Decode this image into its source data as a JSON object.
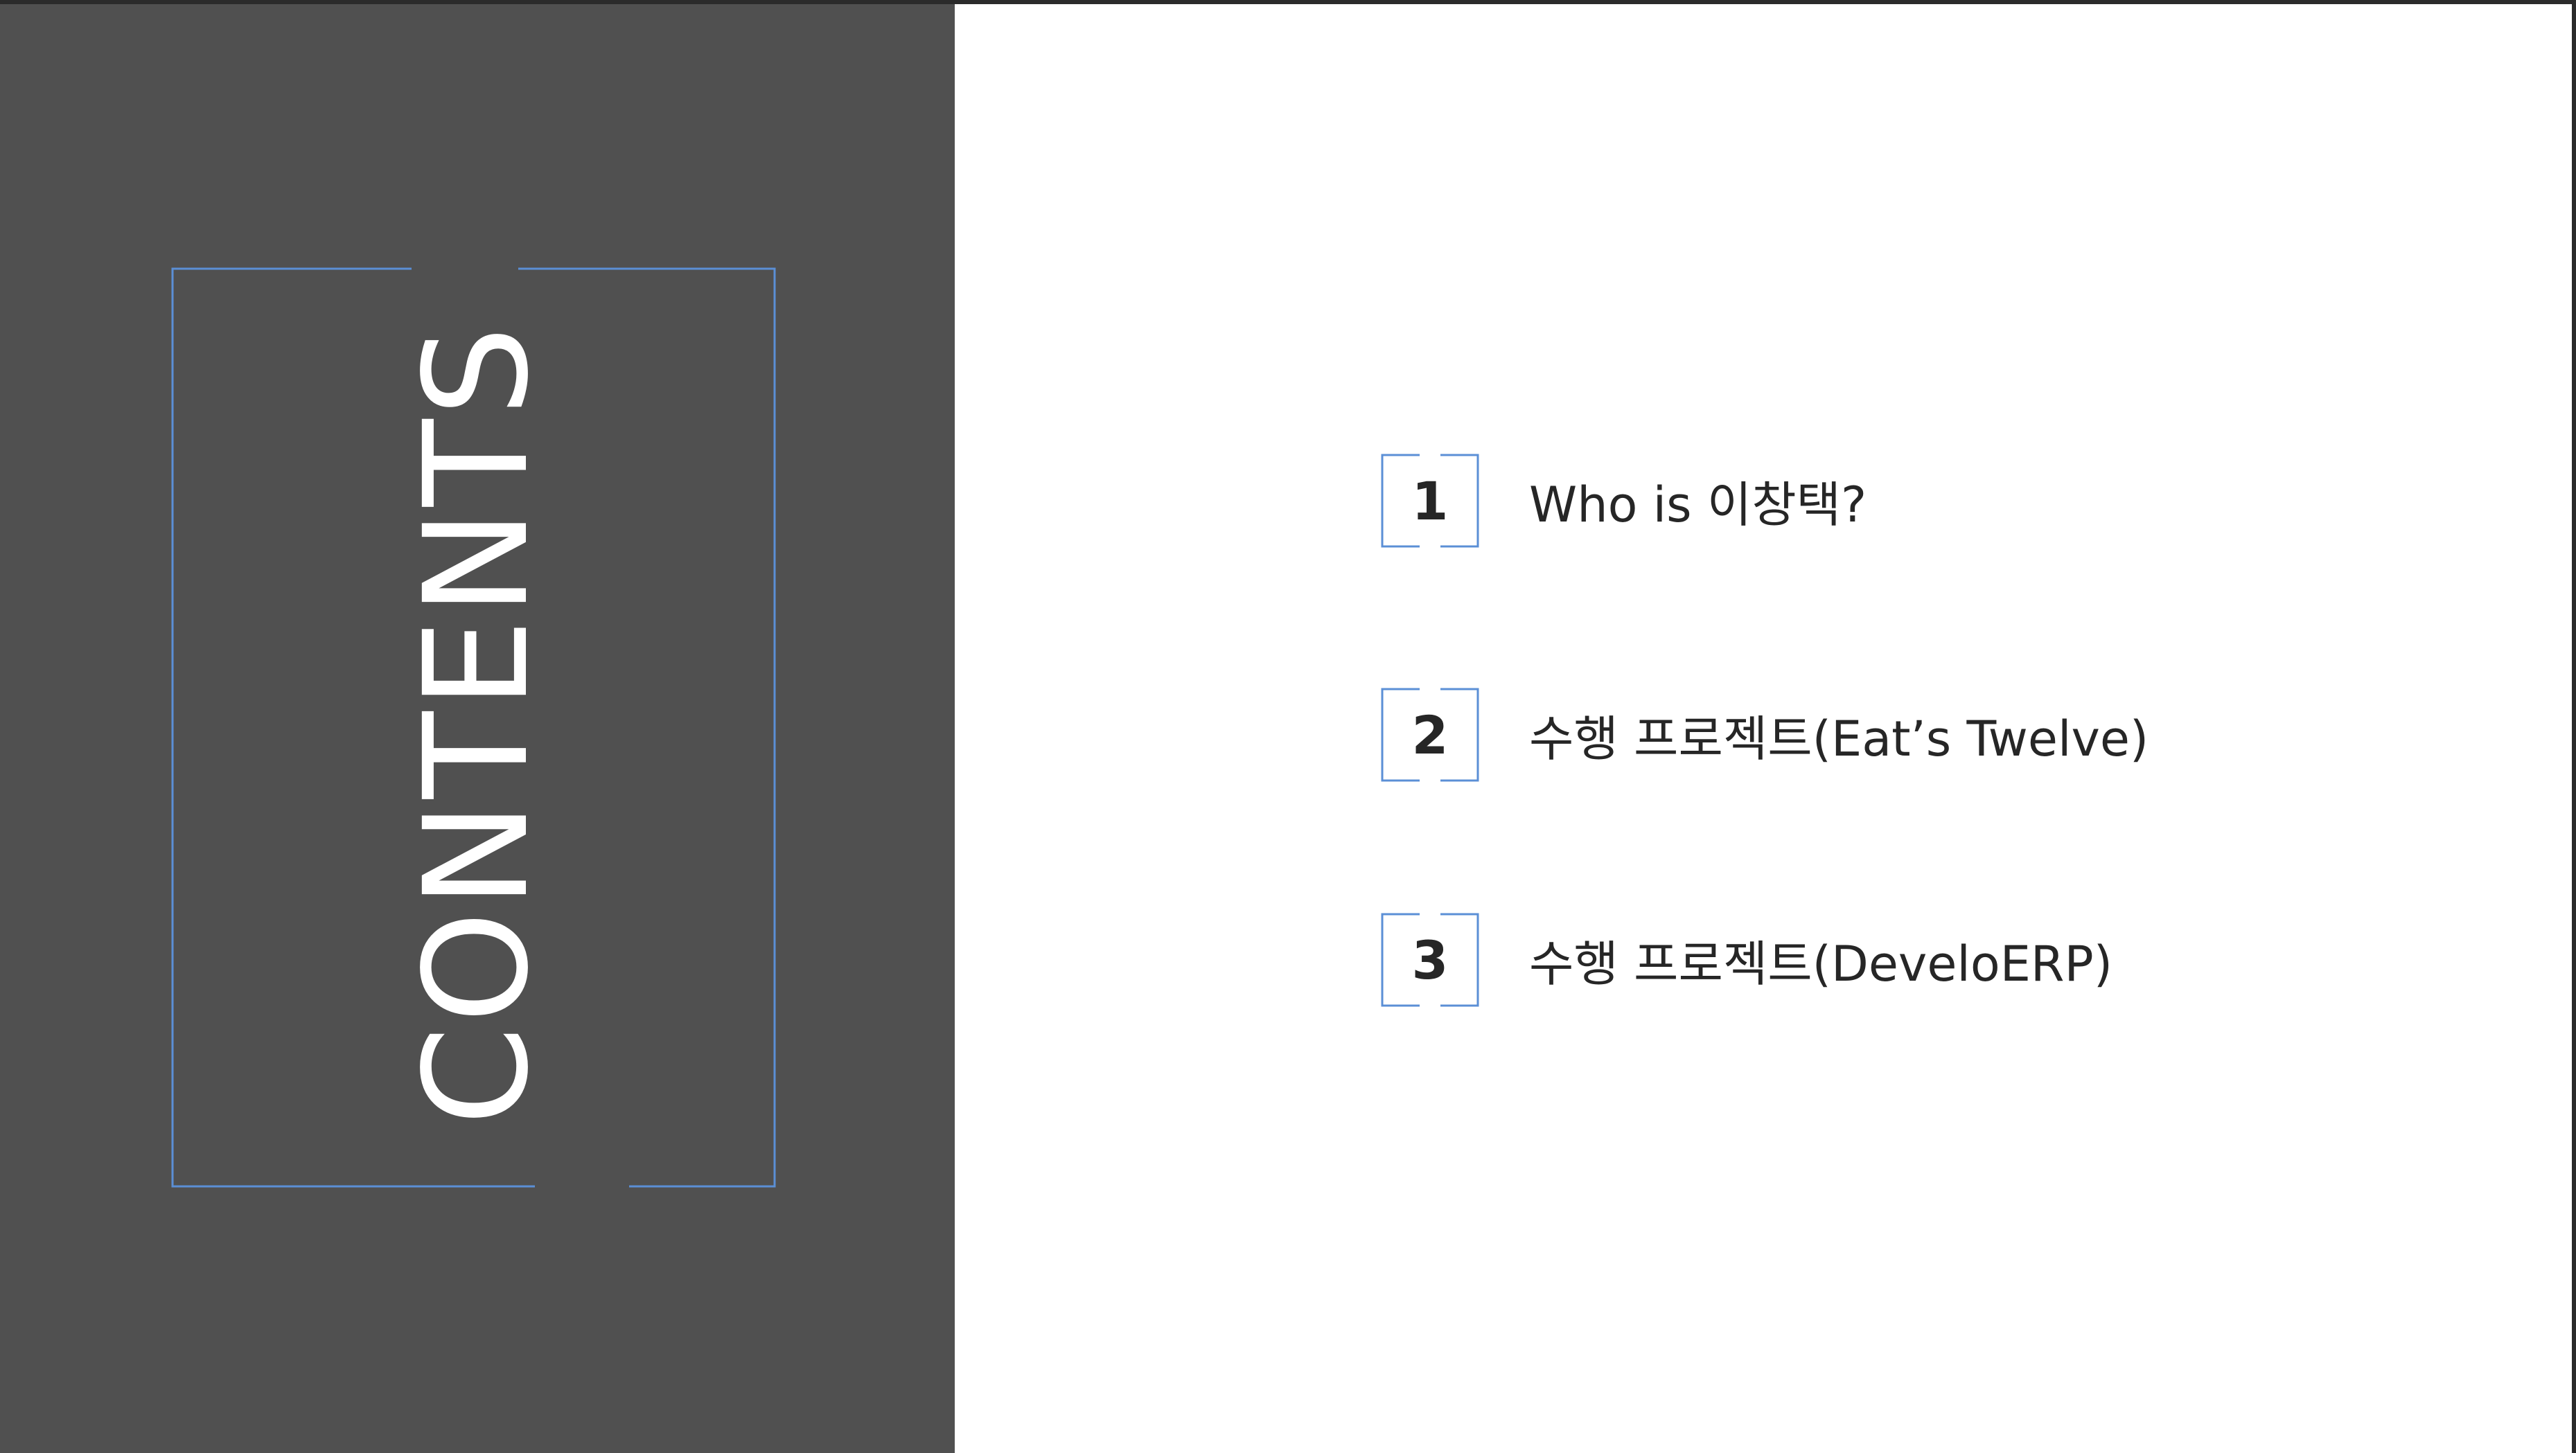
{
  "slide": {
    "title": "CONTENTS",
    "colors": {
      "panel": "#505050",
      "accent": "#5b8fd6",
      "text": "#262626",
      "title_text": "#ffffff",
      "background": "#ffffff"
    }
  },
  "toc": {
    "items": [
      {
        "number": "1",
        "label": "Who is 이창택?"
      },
      {
        "number": "2",
        "label": "수행 프로젝트(Eat’s Twelve)"
      },
      {
        "number": "3",
        "label": "수행 프로젝트(DeveloERP)"
      }
    ]
  }
}
